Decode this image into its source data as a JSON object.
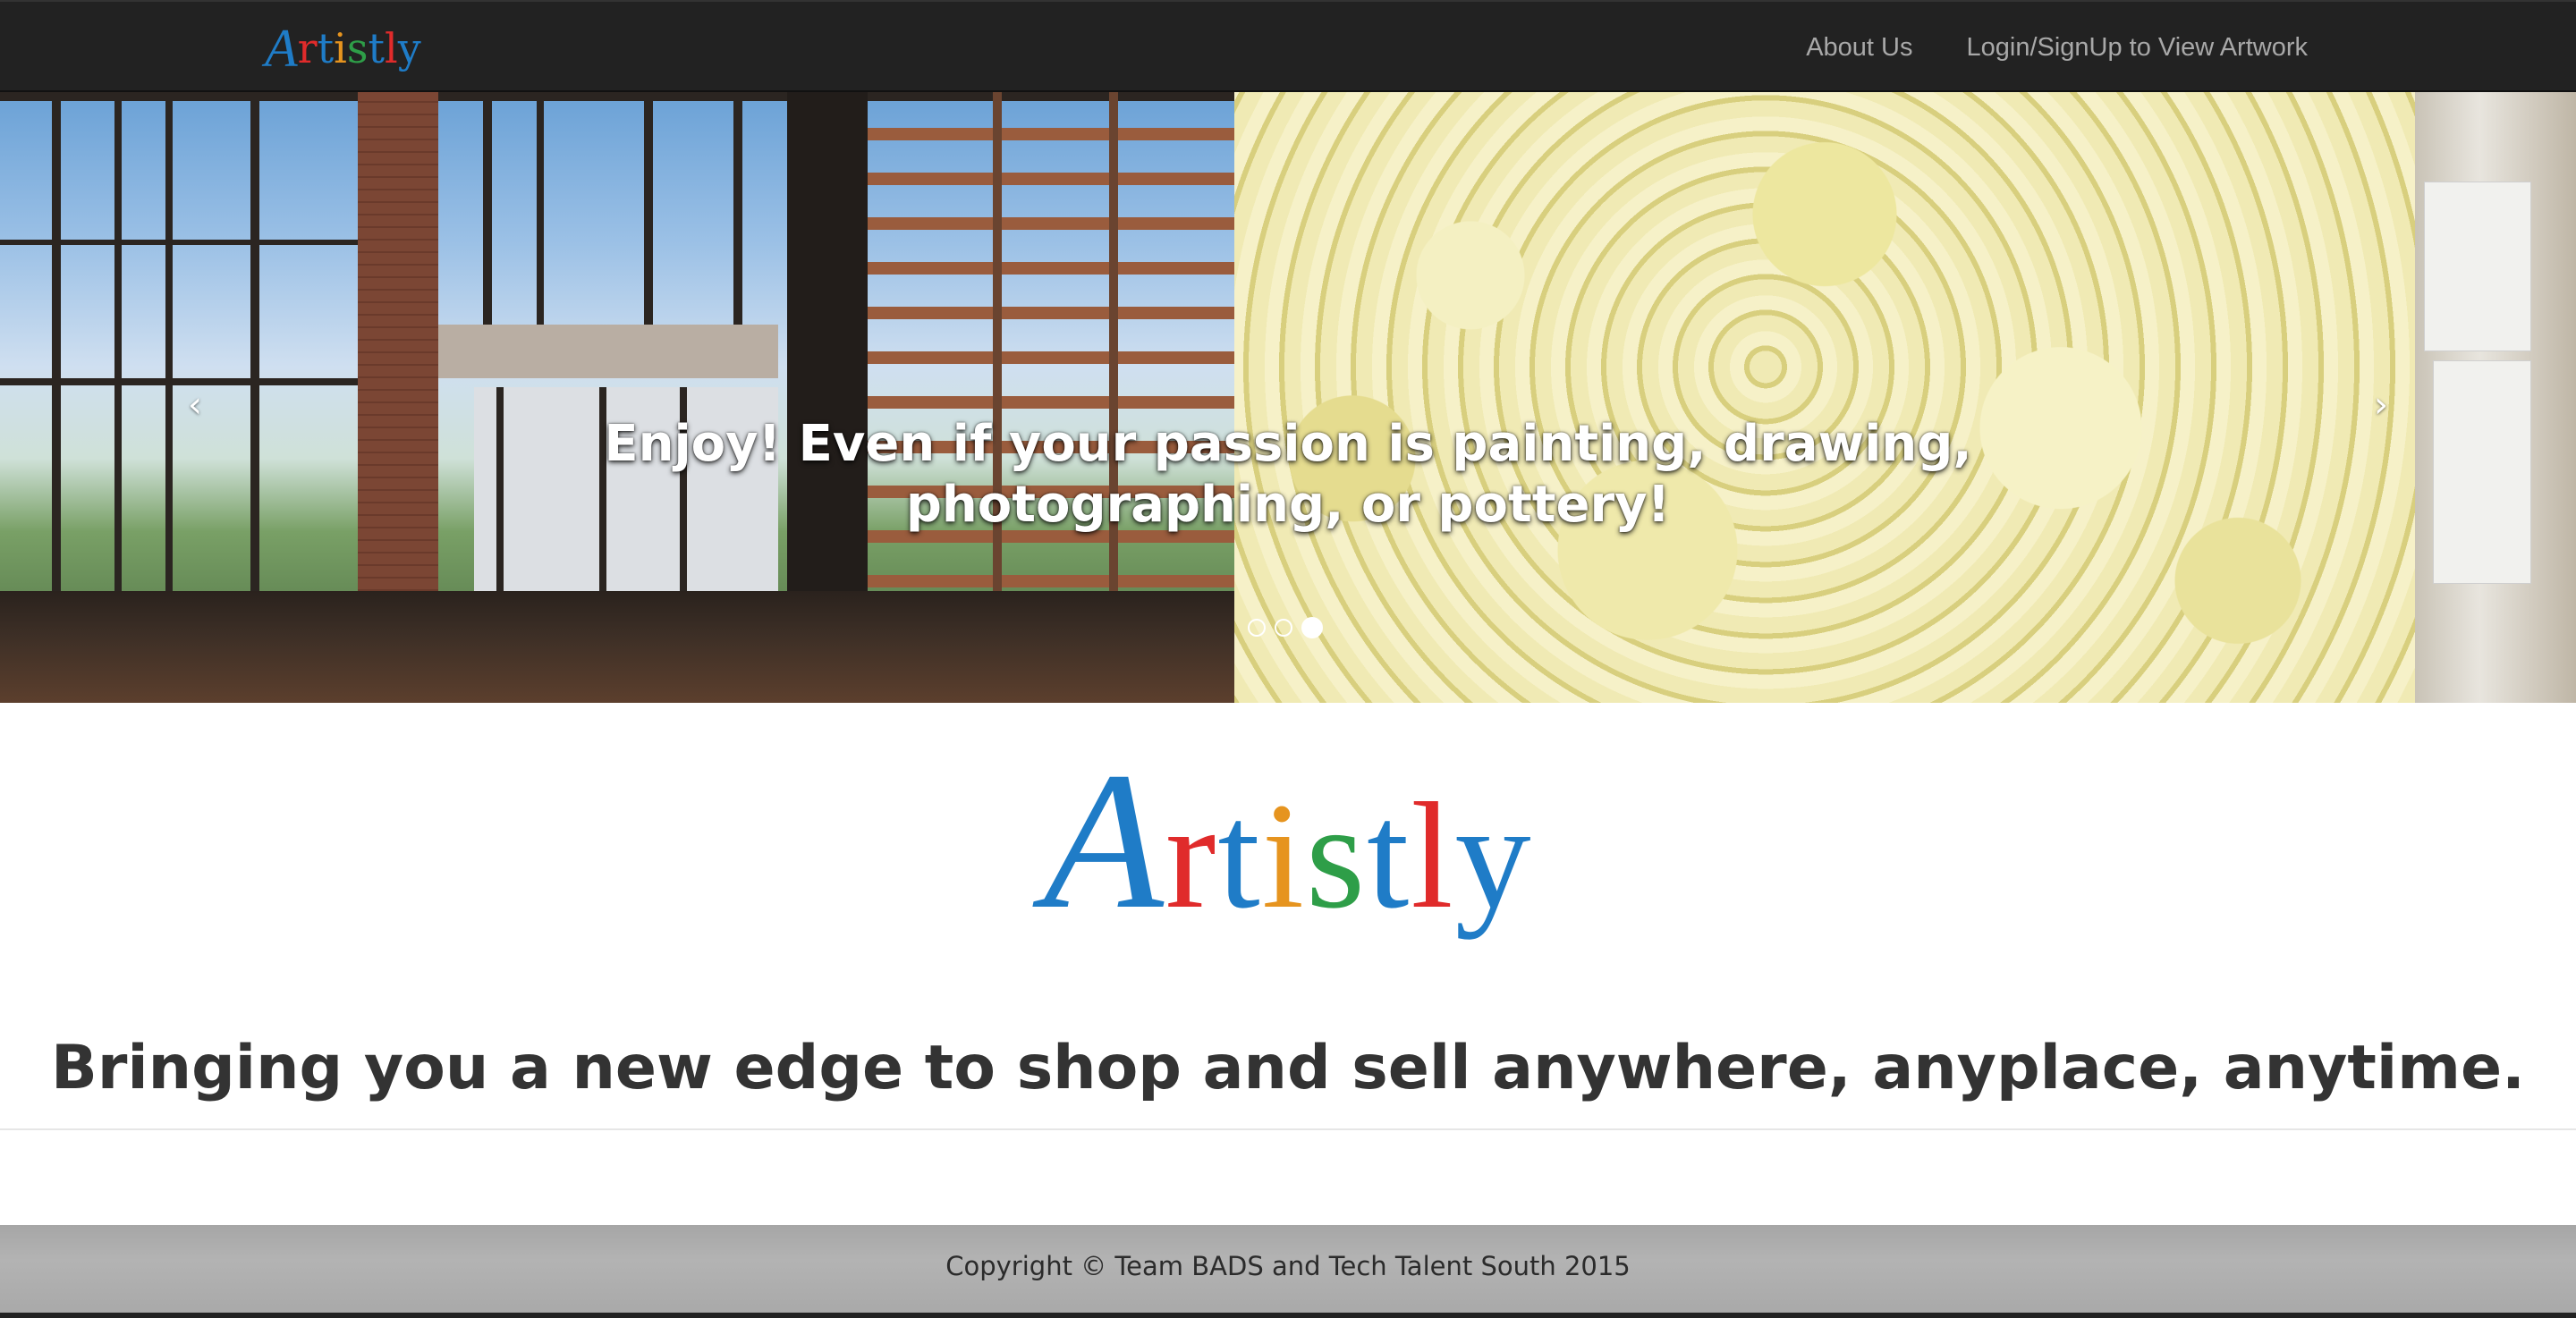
{
  "navbar": {
    "brand": {
      "letters": [
        {
          "char": "A",
          "color": "#1f7cc7"
        },
        {
          "char": "r",
          "color": "#e02b2b"
        },
        {
          "char": "t",
          "color": "#1f7cc7"
        },
        {
          "char": "i",
          "color": "#e6941f"
        },
        {
          "char": "s",
          "color": "#2e9e48"
        },
        {
          "char": "t",
          "color": "#1f7cc7"
        },
        {
          "char": "l",
          "color": "#e02b2b"
        },
        {
          "char": "y",
          "color": "#1f7cc7"
        }
      ]
    },
    "links": [
      {
        "label": "About Us"
      },
      {
        "label": "Login/SignUp to View Artwork"
      }
    ],
    "background": "#222222",
    "link_color": "#a8a8a8"
  },
  "carousel": {
    "caption_line1": "Enjoy! Even if your passion is painting, drawing,",
    "caption_line2": "photographing, or pottery!",
    "prev_icon": "chevron-left-icon",
    "next_icon": "chevron-right-icon",
    "prev_glyph": "‹",
    "next_glyph": "›",
    "slide_count": 3,
    "active_index": 2
  },
  "main": {
    "logo_letters": [
      {
        "char": "A",
        "color": "#1f7cc7"
      },
      {
        "char": "r",
        "color": "#e02b2b"
      },
      {
        "char": "t",
        "color": "#1f7cc7"
      },
      {
        "char": "i",
        "color": "#e6941f"
      },
      {
        "char": "s",
        "color": "#2e9e48"
      },
      {
        "char": "t",
        "color": "#1f7cc7"
      },
      {
        "char": "l",
        "color": "#e02b2b"
      },
      {
        "char": "y",
        "color": "#1f7cc7"
      }
    ],
    "tagline": "Bringing you a new edge to shop and sell anywhere, anyplace, anytime."
  },
  "footer": {
    "text": "Copyright © Team BADS and Tech Talent South 2015",
    "background": "#b0b0b0"
  }
}
